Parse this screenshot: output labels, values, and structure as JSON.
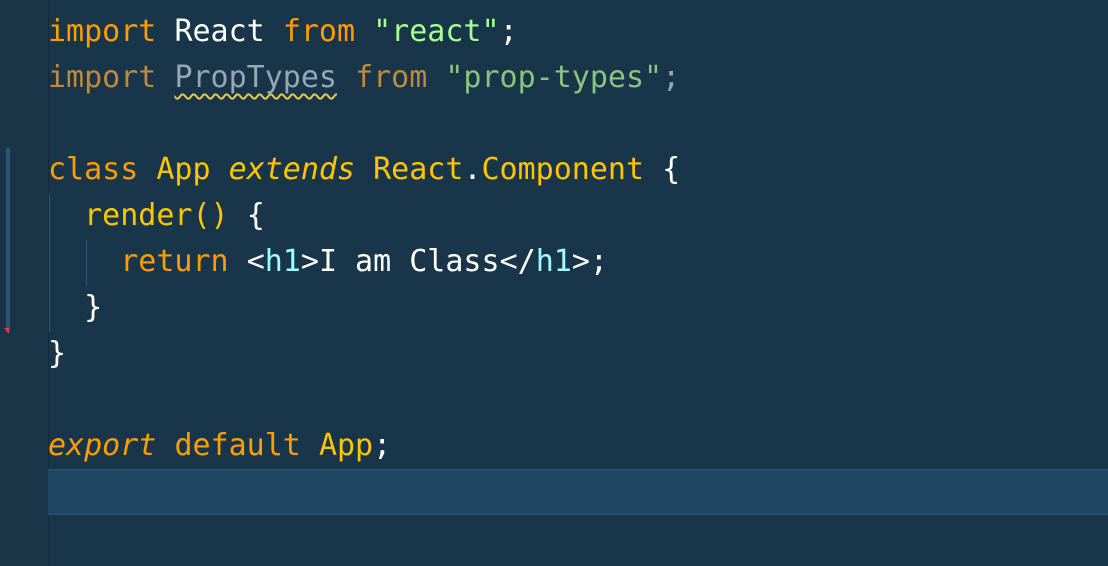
{
  "editor": {
    "colors": {
      "background": "#193549",
      "keyword": "#ff9d00",
      "string": "#a5ff90",
      "class_name": "#ffc600",
      "jsx_tag": "#9effff",
      "current_line": "#1f4662",
      "squiggle_warning": "#e8c94a",
      "git_modified": "#2c5678",
      "git_deleted": "#e03a3a"
    },
    "lines": {
      "l1": {
        "import": "import",
        "name": "React",
        "from": "from",
        "module": "\"react\"",
        "semi": ";"
      },
      "l2": {
        "import": "import",
        "name": "PropTypes",
        "from": "from",
        "module": "\"prop-types\"",
        "semi": ";"
      },
      "l4": {
        "class_kw": "class",
        "name": "App",
        "extends_kw": "extends",
        "base_obj": "React",
        "dot": ".",
        "base_member": "Component",
        "brace": "{"
      },
      "l5": {
        "method": "render",
        "parens": "()",
        "brace": "{"
      },
      "l6": {
        "return_kw": "return",
        "lt": "<",
        "open_tag": "h1",
        "gt": ">",
        "text": "I am Class",
        "lt_close": "</",
        "close_tag": "h1",
        "gt_close": ">",
        "semi": ";"
      },
      "l7": {
        "brace": "}"
      },
      "l8": {
        "brace": "}"
      },
      "l10": {
        "export_kw": "export",
        "default_kw": "default",
        "name": "App",
        "semi": ";"
      }
    }
  }
}
